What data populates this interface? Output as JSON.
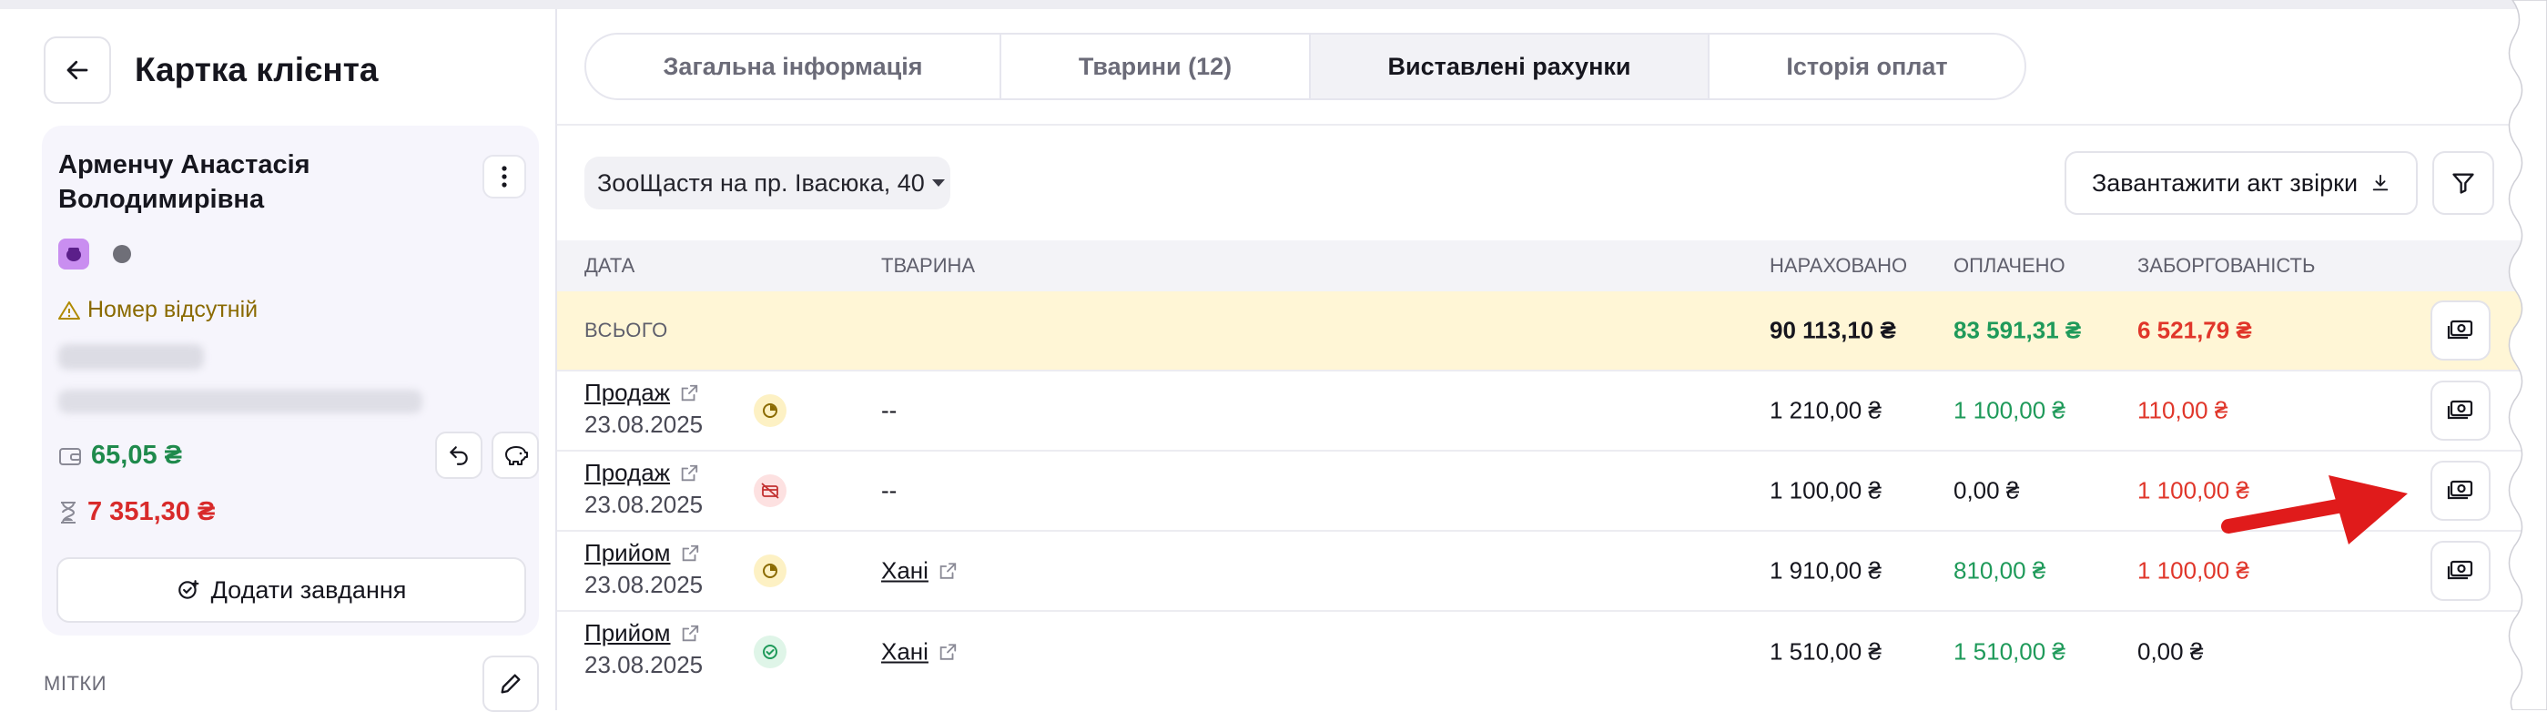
{
  "page": {
    "title": "Картка клієнта"
  },
  "client": {
    "name": "Арменчу Анастасія Володимирівна",
    "phone_warning": "Номер відсутній",
    "balance": "65,05 ₴",
    "debt": "7 351,30 ₴",
    "add_task_label": "Додати завдання",
    "tags_label": "МІТКИ"
  },
  "tabs": [
    {
      "label": "Загальна інформація",
      "active": false
    },
    {
      "label": "Тварини (12)",
      "active": false
    },
    {
      "label": "Виставлені рахунки",
      "active": true
    },
    {
      "label": "Історія оплат",
      "active": false
    }
  ],
  "toolbar": {
    "location": "ЗооЩастя на пр. Івасюка, 40",
    "export_label": "Завантажити акт звірки"
  },
  "table": {
    "headers": {
      "date": "ДАТА",
      "pet": "ТВАРИНА",
      "charged": "НАРАХОВАНО",
      "paid": "ОПЛАЧЕНО",
      "debt": "ЗАБОРГОВАНІСТЬ"
    },
    "total": {
      "label": "ВСЬОГО",
      "charged": "90 113,10 ₴",
      "paid": "83 591,31 ₴",
      "debt": "6 521,79 ₴"
    },
    "rows": [
      {
        "doc": "Продаж",
        "date": "23.08.2025",
        "status": "partial",
        "pet": "--",
        "pet_link": false,
        "charged": "1 210,00 ₴",
        "paid": "1 100,00 ₴",
        "paid_color": "green",
        "debt": "110,00 ₴",
        "debt_color": "red"
      },
      {
        "doc": "Продаж",
        "date": "23.08.2025",
        "status": "unpaid",
        "pet": "--",
        "pet_link": false,
        "charged": "1 100,00 ₴",
        "paid": "0,00 ₴",
        "paid_color": "dark",
        "debt": "1 100,00 ₴",
        "debt_color": "red"
      },
      {
        "doc": "Прийом",
        "date": "23.08.2025",
        "status": "partial",
        "pet": "Хані",
        "pet_link": true,
        "charged": "1 910,00 ₴",
        "paid": "810,00 ₴",
        "paid_color": "green",
        "debt": "1 100,00 ₴",
        "debt_color": "red"
      },
      {
        "doc": "Прийом",
        "date": "23.08.2025",
        "status": "paid",
        "pet": "Хані",
        "pet_link": true,
        "charged": "1 510,00 ₴",
        "paid": "1 510,00 ₴",
        "paid_color": "green",
        "debt": "0,00 ₴",
        "debt_color": "dark"
      }
    ]
  },
  "colors": {
    "accent_green": "#1f9a5a",
    "accent_red": "#e0362a",
    "total_row_bg": "#fff6d6",
    "annotation_arrow": "#e01b1b"
  }
}
